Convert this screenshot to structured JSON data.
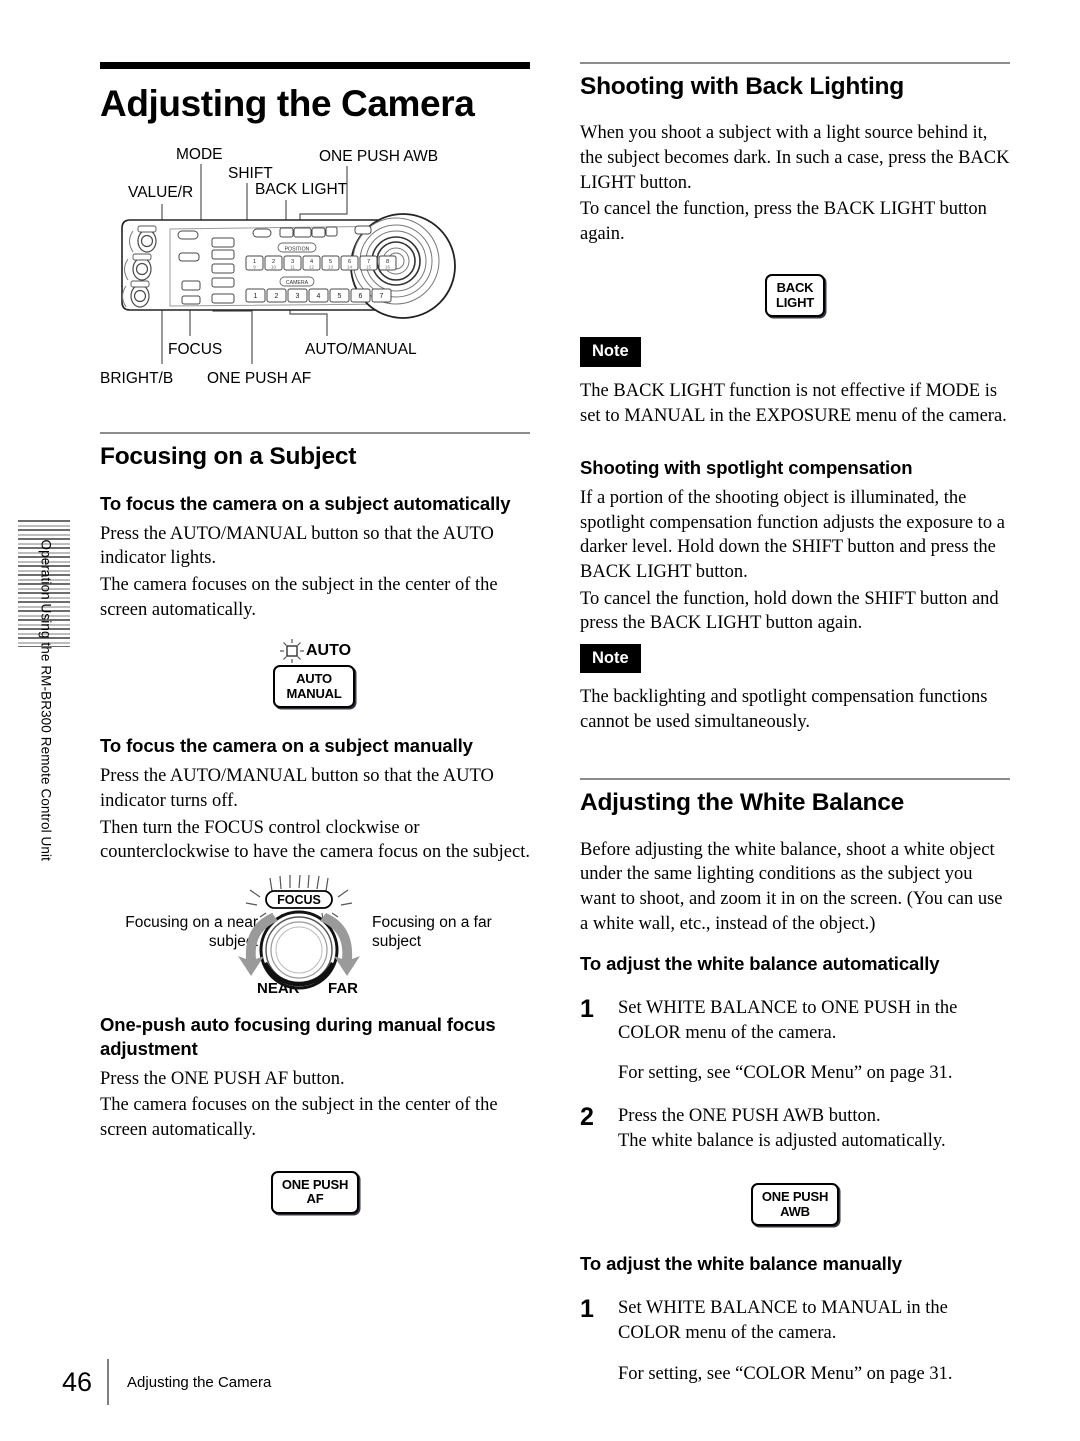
{
  "document": {
    "side_tab_label": "Operation Using the RM-BR300 Remote Control Unit",
    "footer_page_number": "46",
    "footer_section": "Adjusting the Camera"
  },
  "left_column": {
    "title": "Adjusting the Camera",
    "panel_diagram": {
      "callouts": {
        "value_r": "VALUE/R",
        "mode": "MODE",
        "shift": "SHIFT",
        "back_light": "BACK LIGHT",
        "one_push_awb": "ONE PUSH AWB",
        "bright_b": "BRIGHT/B",
        "focus": "FOCUS",
        "one_push_af": "ONE PUSH AF",
        "auto_manual": "AUTO/MANUAL"
      },
      "panel_group_position": "POSITION",
      "panel_group_camera": "CAMERA",
      "position_buttons": [
        "1",
        "2",
        "3",
        "4",
        "5",
        "6",
        "7",
        "8"
      ],
      "position_buttons_alt": [
        "9",
        "10",
        "11",
        "12",
        "13",
        "14",
        "15",
        "16"
      ],
      "camera_buttons": [
        "1",
        "2",
        "3",
        "4",
        "5",
        "6",
        "7"
      ]
    },
    "section_focusing": {
      "heading": "Focusing on a Subject",
      "sub_auto": {
        "heading": "To focus the camera on a subject automatically",
        "p1": "Press the AUTO/MANUAL button so that the AUTO indicator lights.",
        "p2": "The camera focuses on the subject in the center of the screen automatically.",
        "figure": {
          "indicator_label": "AUTO",
          "key_label": "AUTO\nMANUAL"
        }
      },
      "sub_manual": {
        "heading": "To focus the camera on a subject manually",
        "p1": "Press the AUTO/MANUAL button so that the AUTO indicator turns off.",
        "p2": "Then turn the FOCUS control clockwise or counterclockwise to have the camera focus on the subject.",
        "figure": {
          "dial_label": "FOCUS",
          "caption_left": "Focusing on a near subject",
          "caption_right": "Focusing on a far subject",
          "near": "NEAR",
          "far": "FAR"
        }
      },
      "sub_onepush": {
        "heading": "One-push auto focusing during manual focus adjustment",
        "p1": "Press the ONE PUSH AF button.",
        "p2": "The camera focuses on the subject in the center of the screen automatically.",
        "figure": {
          "key_label": "ONE PUSH\nAF"
        }
      }
    }
  },
  "right_column": {
    "section_backlight": {
      "heading": "Shooting with Back Lighting",
      "p1": "When you shoot a subject with a light source behind it, the subject becomes dark.  In such a case, press the BACK LIGHT button.",
      "p2": "To cancel the function, press the BACK LIGHT button again.",
      "figure": {
        "key_label": "BACK\nLIGHT"
      },
      "note_badge": "Note",
      "note_text": "The BACK LIGHT function is not effective if MODE is set to MANUAL in the EXPOSURE menu of the camera."
    },
    "section_spotlight": {
      "heading": "Shooting with spotlight compensation",
      "p1": "If a portion of the shooting object is illuminated, the spotlight compensation function adjusts the exposure to a darker level. Hold down the SHIFT button and press the BACK LIGHT button.",
      "p2": "To cancel the function, hold down the SHIFT button and press the BACK LIGHT button again.",
      "note_badge": "Note",
      "note_text": "The backlighting and spotlight compensation functions cannot be used simultaneously."
    },
    "section_white_balance": {
      "heading": "Adjusting the White Balance",
      "intro": "Before adjusting the white balance, shoot a white object under the same lighting conditions as the subject you want to shoot, and zoom it in on the screen. (You can use a white wall, etc., instead of the object.)",
      "sub_auto": {
        "heading": "To adjust the white balance automatically",
        "steps": [
          {
            "number": "1",
            "text": "Set WHITE BALANCE to ONE PUSH in the COLOR menu of the camera.",
            "note": "For setting, see “COLOR Menu” on page 31."
          },
          {
            "number": "2",
            "text": "Press the ONE PUSH AWB button.\nThe white balance is adjusted automatically."
          }
        ],
        "figure": {
          "key_label": "ONE PUSH\nAWB"
        }
      },
      "sub_manual": {
        "heading": "To adjust the white balance manually",
        "steps": [
          {
            "number": "1",
            "text": "Set WHITE BALANCE to MANUAL in the COLOR menu of the camera.",
            "note": "For setting, see “COLOR Menu” on page 31."
          }
        ]
      }
    }
  }
}
